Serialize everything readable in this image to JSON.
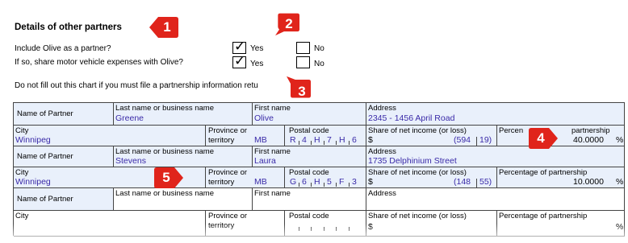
{
  "section": {
    "title": "Details of other partners",
    "q1": "Include Olive as a partner?",
    "q2": "If so, share motor vehicle expenses with Olive?",
    "yes": "Yes",
    "no": "No",
    "notice": "Do not fill out this chart if you must file a partnership information retu"
  },
  "labels": {
    "name_of_partner": "Name of Partner",
    "last_name": "Last name or business name",
    "first_name": "First name",
    "address": "Address",
    "city": "City",
    "province_line1": "Province or",
    "province_line2": "territory",
    "postal_code": "Postal code",
    "share": "Share of net income (or loss)",
    "percentage": "Percentage of partnership",
    "percentage_cut": "Percen",
    "dollar": "$",
    "percent_sign": "%"
  },
  "partners": [
    {
      "last": "Greene",
      "first": "Olive",
      "address": "2345 - 1456 April Road",
      "city": "Winnipeg",
      "province": "MB",
      "postal": [
        "R",
        "4",
        "H",
        "7",
        "H",
        "6"
      ],
      "share_dollars": "(594",
      "share_cents": "19)",
      "percentage": "40.0000"
    },
    {
      "last": "Stevens",
      "first": "Laura",
      "address": "1735 Delphinium Street",
      "city": "Winnipeg",
      "province": "MB",
      "postal": [
        "G",
        "6",
        "H",
        "5",
        "F",
        "3"
      ],
      "share_dollars": "(148",
      "share_cents": "55)",
      "percentage": "10.0000"
    }
  ],
  "callouts": [
    "1",
    "2",
    "3",
    "4",
    "5"
  ],
  "colors": {
    "callout_red": "#e0241b",
    "value_blue": "#3a2aa8",
    "cell_bg": "#e9f0fb"
  }
}
